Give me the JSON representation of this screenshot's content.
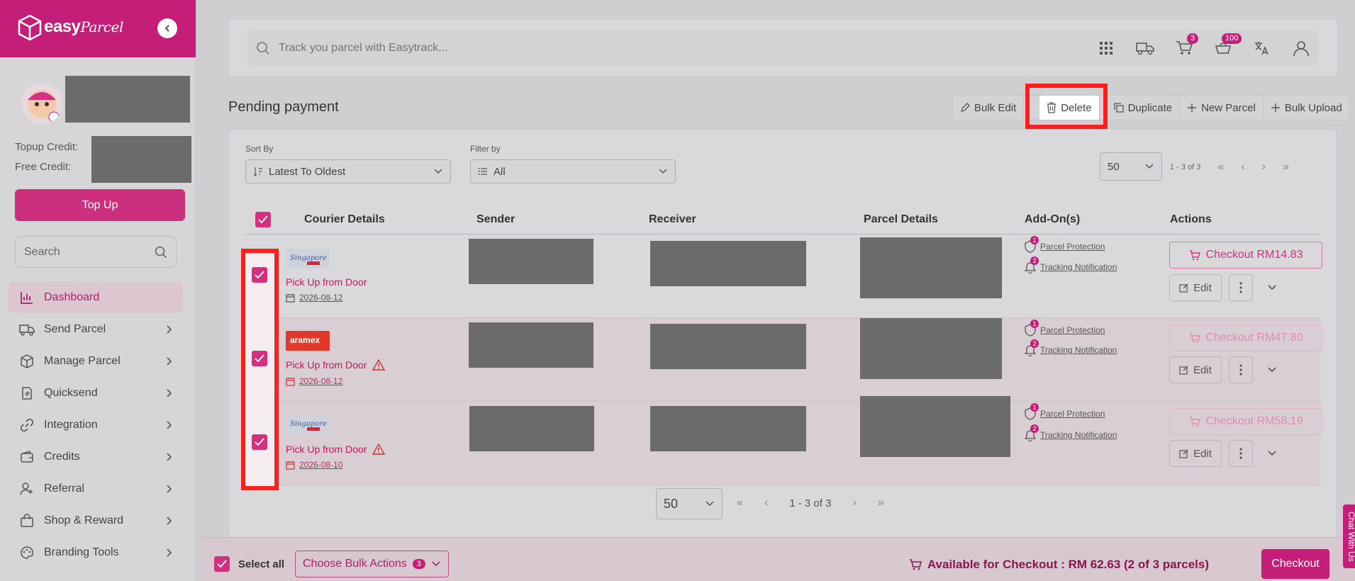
{
  "brand": {
    "logo_text": "easy",
    "logo_script": "Parcel"
  },
  "profile": {
    "topup_label": "Topup Credit:",
    "free_label": "Free Credit:",
    "topup_button": "Top Up"
  },
  "sidebar": {
    "search_placeholder": "Search",
    "items": [
      {
        "label": "Dashboard",
        "icon": "chart-bar-icon"
      },
      {
        "label": "Send Parcel",
        "icon": "truck-icon"
      },
      {
        "label": "Manage Parcel",
        "icon": "box-icon"
      },
      {
        "label": "Quicksend",
        "icon": "quicksend-icon"
      },
      {
        "label": "Integration",
        "icon": "link-icon"
      },
      {
        "label": "Credits",
        "icon": "wallet-icon"
      },
      {
        "label": "Referral",
        "icon": "user-plus-icon"
      },
      {
        "label": "Shop & Reward",
        "icon": "shopping-bag-icon"
      },
      {
        "label": "Branding Tools",
        "icon": "palette-icon"
      }
    ]
  },
  "topbar": {
    "search_placeholder": "Track you parcel with Easytrack...",
    "cart_count": "3",
    "notif_count": "100"
  },
  "page": {
    "title": "Pending payment"
  },
  "actions": {
    "bulk_edit": "Bulk Edit",
    "delete": "Delete",
    "duplicate": "Duplicate",
    "new_parcel": "New Parcel",
    "bulk_upload": "Bulk Upload"
  },
  "filters": {
    "sort_label": "Sort By",
    "sort_value": "Latest To Oldest",
    "filter_label": "Filter by",
    "filter_value": "All",
    "per_page": "50",
    "range": "1 - 3 of 3",
    "bottom_range": "1 - 3 of 3"
  },
  "table": {
    "headers": [
      "Courier Details",
      "Sender",
      "Receiver",
      "Parcel Details",
      "Add-On(s)",
      "Actions"
    ],
    "rows": [
      {
        "courier": "singpost",
        "pickup": "Pick Up from Door",
        "date": "2026-08-12",
        "warning": false,
        "checkout": "Checkout RM14.83",
        "dim": false
      },
      {
        "courier": "aramex",
        "pickup": "Pick Up from Door",
        "date": "2026-08-12",
        "warning": true,
        "checkout": "Checkout RM47.80",
        "dim": true
      },
      {
        "courier": "singpost",
        "pickup": "Pick Up from Door",
        "date": "2026-08-10",
        "warning": true,
        "checkout": "Checkout RM58.19",
        "dim": true
      }
    ],
    "addons": {
      "protection": "Parcel Protection",
      "tracking": "Tracking Notification",
      "protection_count": "1",
      "tracking_count": "2"
    },
    "edit_label": "Edit"
  },
  "bottom": {
    "select_all": "Select all",
    "bulk_actions": "Choose Bulk Actions",
    "bulk_count": "3",
    "available": "Available for Checkout : RM 62.63 (2 of 3 parcels)",
    "checkout": "Checkout",
    "chat": "Chat With Us"
  },
  "colors": {
    "brand": "#c41e78",
    "highlight": "#ff1e1e"
  }
}
